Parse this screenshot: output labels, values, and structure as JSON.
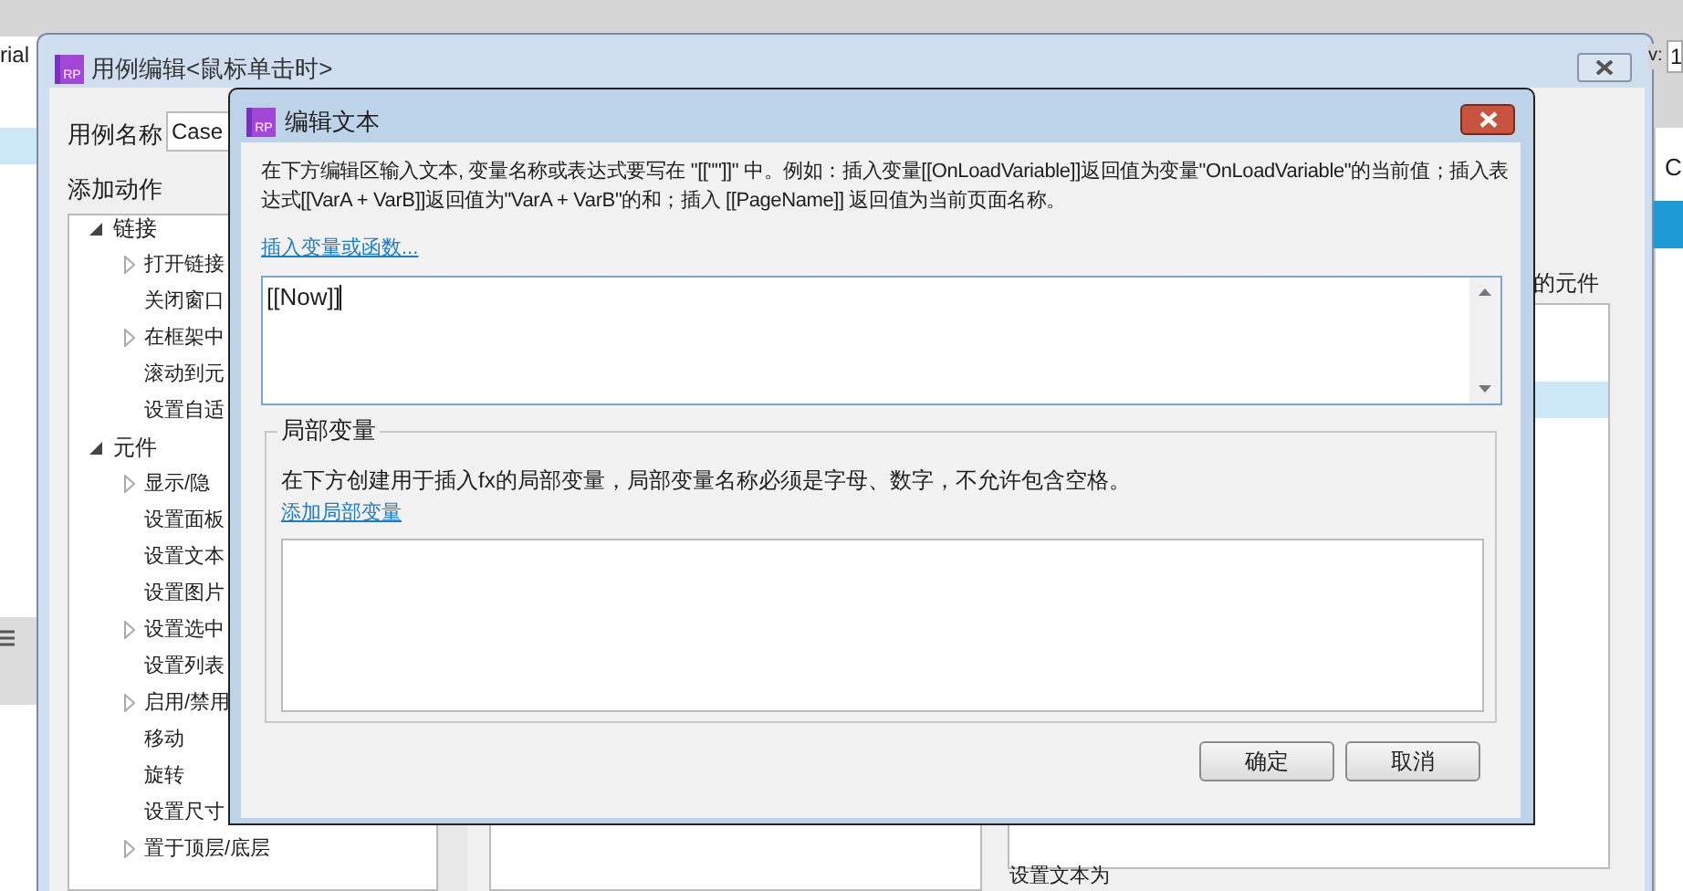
{
  "background": {
    "font_field": "rial",
    "right_label": "v:",
    "right_value": "1",
    "right_panel_text": "C"
  },
  "outer_dialog": {
    "logo": "RP",
    "title": "用例编辑<鼠标单击时>",
    "case_name_label": "用例名称",
    "case_name_value": "Case",
    "add_action_label": "添加动作",
    "tree": [
      {
        "label": "链接",
        "expanded": true,
        "children": [
          {
            "label": "打开链接",
            "expandable": true
          },
          {
            "label": "关闭窗口",
            "expandable": false
          },
          {
            "label": "在框架中",
            "expandable": true
          },
          {
            "label": "滚动到元",
            "expandable": false
          },
          {
            "label": "设置自适",
            "expandable": false
          }
        ]
      },
      {
        "label": "元件",
        "expanded": true,
        "children": [
          {
            "label": "显示/隐",
            "expandable": true
          },
          {
            "label": "设置面板",
            "expandable": false
          },
          {
            "label": "设置文本",
            "expandable": false
          },
          {
            "label": "设置图片",
            "expandable": false
          },
          {
            "label": "设置选中",
            "expandable": true
          },
          {
            "label": "设置列表",
            "expandable": false
          },
          {
            "label": "启用/禁用",
            "expandable": true
          },
          {
            "label": "移动",
            "expandable": false
          },
          {
            "label": "旋转",
            "expandable": false
          },
          {
            "label": "设置尺寸",
            "expandable": false
          },
          {
            "label": "置于顶层/底层",
            "expandable": true
          }
        ]
      }
    ],
    "right_heading": "的元件",
    "right_footer": "设置文本为"
  },
  "dialog": {
    "logo": "RP",
    "title": "编辑文本",
    "instructions": "在下方编辑区输入文本, 变量名称或表达式要写在 \"[[\"\"]]\" 中。例如：插入变量[[OnLoadVariable]]返回值为变量\"OnLoadVariable\"的当前值；插入表达式[[VarA + VarB]]返回值为\"VarA + VarB\"的和；插入 [[PageName]] 返回值为当前页面名称。",
    "insert_link": "插入变量或函数...",
    "text_value": "[[Now]]",
    "local_vars": {
      "legend": "局部变量",
      "description": "在下方创建用于插入fx的局部变量，局部变量名称必须是字母、数字，不允许包含空格。",
      "add_link": "添加局部变量"
    },
    "buttons": [
      "确定",
      "取消"
    ]
  }
}
